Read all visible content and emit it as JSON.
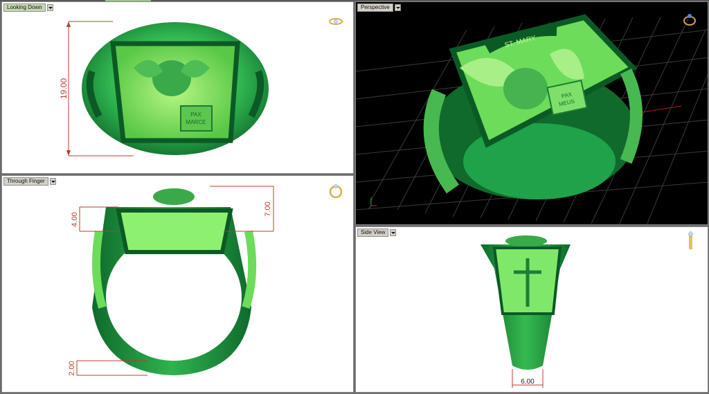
{
  "viewports": {
    "looking_down": {
      "label": "Looking Down",
      "dimension": "19.00",
      "icon": "ring-top-icon"
    },
    "perspective": {
      "label": "Perspective",
      "icon": "ring-perspective-icon"
    },
    "through_finger": {
      "label": "Through Finger",
      "dim_top_left": "4.00",
      "dim_top_right": "7.00",
      "dim_bottom": "2.00",
      "icon": "ring-front-icon"
    },
    "side_view": {
      "label": "Side View",
      "dim_bottom": "6.00",
      "icon": "ring-side-icon"
    }
  },
  "engraving": {
    "band_text": "ST. MARY",
    "book_text_1": "PAX",
    "book_text_2": "MARCE",
    "book_text_3": "MEUS"
  },
  "colors": {
    "ring_green": "#1fa24a",
    "ring_highlight": "#7fe86a",
    "dim_red": "#c0392b",
    "grid_line": "#3a3a3a"
  }
}
